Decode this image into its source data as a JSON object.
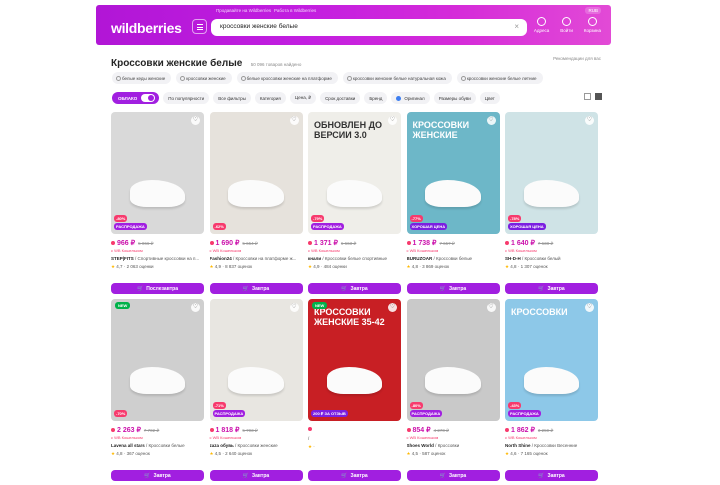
{
  "header": {
    "top_link_1": "Продавайте на Wildberries",
    "top_link_2": "Работа в Wildberries",
    "currency": "RUB",
    "logo": "wildberries",
    "search_value": "кроссовки женские белые",
    "icons": [
      {
        "label": "Адреса",
        "icon": "location-icon"
      },
      {
        "label": "Войти",
        "icon": "user-icon"
      },
      {
        "label": "Корзина",
        "icon": "cart-icon"
      }
    ]
  },
  "results": {
    "title": "Кроссовки женские белые",
    "count": "50 096 товаров найдено",
    "advertising": "Рекомендации для вас"
  },
  "tags": [
    "белые кеды женские",
    "кроссовки женские",
    "белые кроссовки женские на платформе",
    "кроссовки женские белые натуральная кожа",
    "кроссовки женские белые летние"
  ],
  "filters": {
    "sale": "ОБЛАКО",
    "items": [
      "По популярности",
      "Все фильтры",
      "Категория",
      "Цена, ₽",
      "Срок доставки",
      "Бренд",
      "Оригинал",
      "Размеры обуви",
      "Цвет"
    ]
  },
  "colors": {
    "accent": "#a11fe0",
    "price": "#cb11ab",
    "discount": "#f73a6d"
  },
  "products": [
    {
      "price": "966 ₽",
      "old": "5 066 ₽",
      "wb": "с WB Кошельком",
      "brand": "STEP|FITS",
      "desc": "Спортивные кроссовки на п...",
      "rating": "4,7",
      "reviews": "2 063 оценки",
      "button": "Послезавтра",
      "disc": "-80%",
      "badge": "РАСПРОДАЖА",
      "bg": "#d9d9d9",
      "banner": ""
    },
    {
      "price": "1 690 ₽",
      "old": "5 654 ₽",
      "wb": "с WB Кошельком",
      "brand": "Fashion24",
      "desc": "Кроссовки на платформе ж...",
      "rating": "4,9",
      "reviews": "8 837 оценок",
      "button": "Завтра",
      "disc": "-62%",
      "badge": "",
      "bg": "#e6e2dc",
      "banner": ""
    },
    {
      "price": "1 371 ₽",
      "old": "6 663 ₽",
      "wb": "с WB Кошельком",
      "brand": "кнали",
      "desc": "Кроссовки белые спортивные",
      "rating": "4,9",
      "reviews": "484 оценки",
      "button": "Завтра",
      "disc": "-79%",
      "badge": "РАСПРОДАЖА",
      "bg": "#efeee9",
      "banner": "ОБНОВЛЕН ДО ВЕРСИИ 3.0"
    },
    {
      "price": "1 738 ₽",
      "old": "7 657 ₽",
      "wb": "с WB Кошельком",
      "brand": "BURUZOAR",
      "desc": "Кроссовки белые",
      "rating": "4,8",
      "reviews": "3 869 оценок",
      "button": "Завтра",
      "disc": "-77%",
      "badge": "ХОРОШАЯ ЦЕНА",
      "bg": "#6db7c8",
      "banner": "КРОССОВКИ ЖЕНСКИЕ"
    },
    {
      "price": "1 640 ₽",
      "old": "7 638 ₽",
      "wb": "с WB Кошельком",
      "brand": "SH-D-H",
      "desc": "Кроссовки белый",
      "rating": "4,8",
      "reviews": "1 307 оценок",
      "button": "Завтра",
      "disc": "-78%",
      "badge": "ХОРОШАЯ ЦЕНА",
      "bg": "#cfe3e6",
      "banner": ""
    },
    {
      "price": "2 263 ₽",
      "old": "7 702 ₽",
      "wb": "с WB Кошельком",
      "brand": "Lavena all stars",
      "desc": "Кроссовки белые",
      "rating": "4,8",
      "reviews": "367 оценок",
      "button": "Завтра",
      "disc": "-70%",
      "badge": "",
      "bg": "#cfcfcf",
      "banner": ""
    },
    {
      "price": "1 818 ₽",
      "old": "5 703 ₽",
      "wb": "с WB Кошельком",
      "brand": "zaza обувь",
      "desc": "Кроссовки женские",
      "rating": "4,5",
      "reviews": "2 640 оценок",
      "button": "Завтра",
      "disc": "-71%",
      "badge": "РАСПРОДАЖА",
      "bg": "#e8e6e1",
      "banner": ""
    },
    {
      "price": "",
      "old": "",
      "wb": "",
      "brand": "",
      "desc": "",
      "rating": "",
      "reviews": "",
      "button": "Завтра",
      "disc": "",
      "badge": "200 ₽ ЗА ОТЗЫВ",
      "bg": "#c81f24",
      "banner": "КРОССОВКИ ЖЕНСКИЕ 35-42"
    },
    {
      "price": "854 ₽",
      "old": "4 270 ₽",
      "wb": "с WB Кошельком",
      "brand": "Shoes World",
      "desc": "Кроссовки",
      "rating": "4,5",
      "reviews": "587 оценок",
      "button": "Завтра",
      "disc": "-80%",
      "badge": "РАСПРОДАЖА",
      "bg": "#c9c9c9",
      "banner": ""
    },
    {
      "price": "1 862 ₽",
      "old": "3 259 ₽",
      "wb": "с WB Кошельком",
      "brand": "North Shine",
      "desc": "Кроссовки Весенние",
      "rating": "4,6",
      "reviews": "7 165 оценок",
      "button": "Завтра",
      "disc": "-43%",
      "badge": "РАСПРОДАЖА",
      "bg": "#8dc8e8",
      "banner": "КРОССОВКИ"
    }
  ]
}
